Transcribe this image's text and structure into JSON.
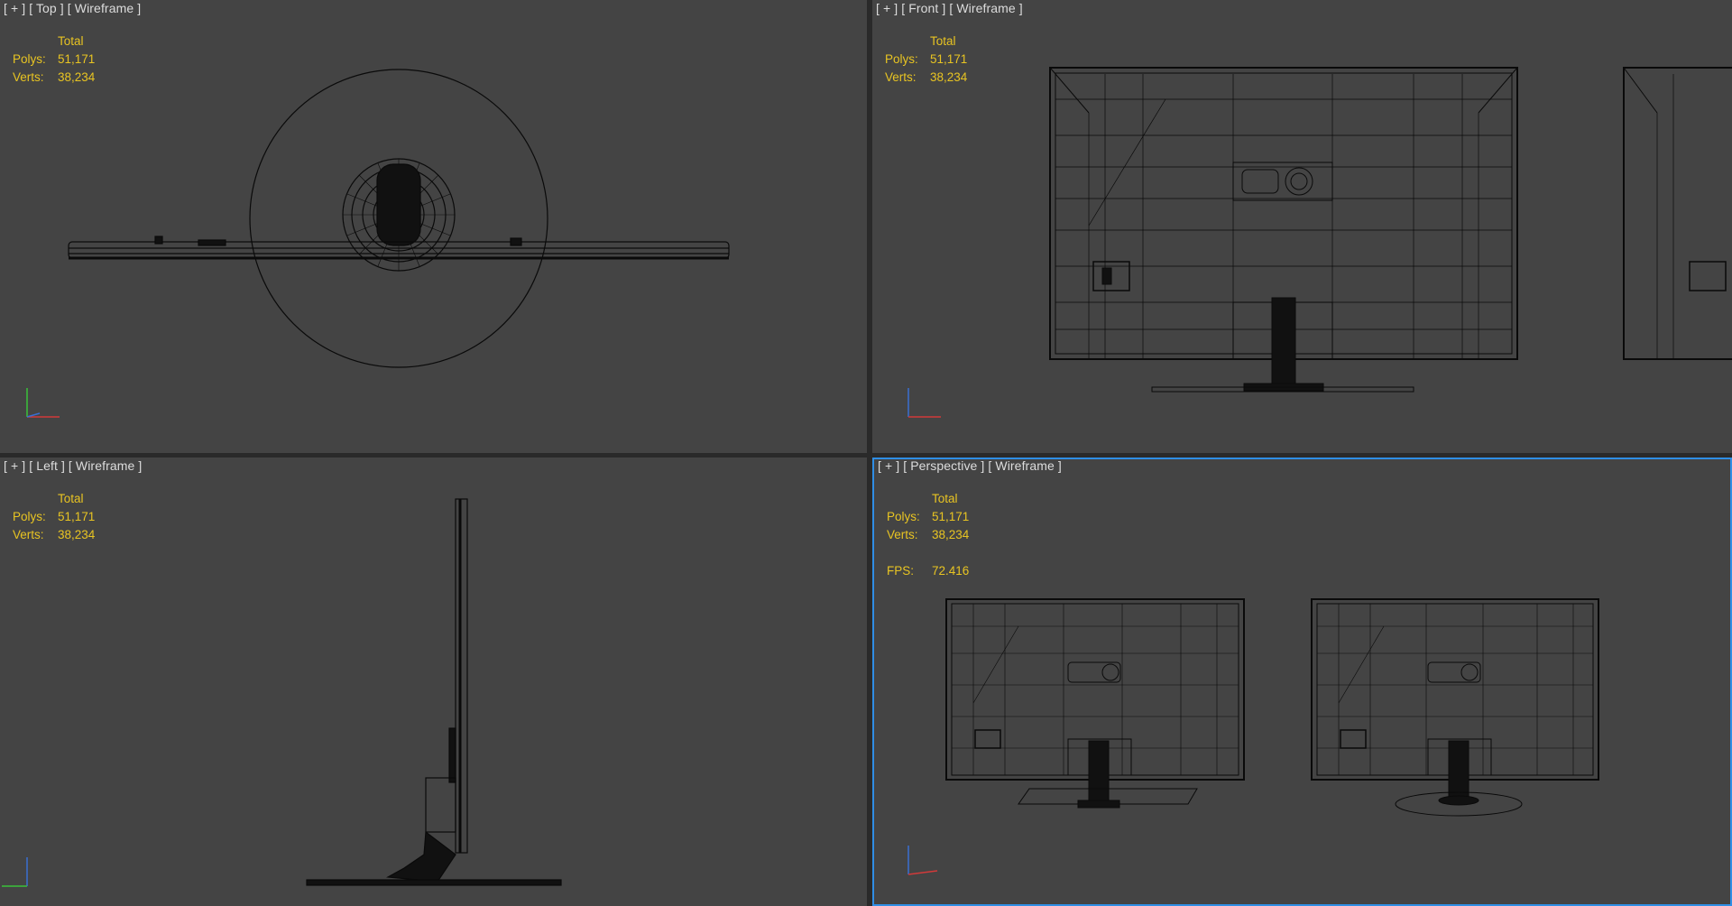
{
  "viewports": {
    "top": {
      "label": "[ + ] [ Top ] [ Wireframe ]",
      "axis_labels": [
        "y",
        "z",
        "x"
      ]
    },
    "front": {
      "label": "[ + ] [ Front ] [ Wireframe ]",
      "axis_labels": [
        "z",
        "x"
      ]
    },
    "left": {
      "label": "[ + ] [ Left ] [ Wireframe ]",
      "axis_labels": [
        "z",
        "y"
      ]
    },
    "perspective": {
      "label": "[ + ] [ Perspective ] [ Wireframe ]",
      "axis_labels": [
        "z",
        "x"
      ],
      "active": true
    }
  },
  "stats": {
    "total_label": "Total",
    "polys_label": "Polys:",
    "polys_value": "51,171",
    "verts_label": "Verts:",
    "verts_value": "38,234",
    "fps_label": "FPS:",
    "fps_value": "72.416"
  },
  "colors": {
    "viewport_bg": "#444444",
    "grid_gap": "#2a2a2a",
    "label_text": "#dcdcdc",
    "stats_text": "#e8c422",
    "wireframe": "#0a0a0a",
    "active_border": "#2f8ee5",
    "axis_x": "#d23a3a",
    "axis_y": "#3ac23a",
    "axis_z": "#3a6ed2"
  }
}
